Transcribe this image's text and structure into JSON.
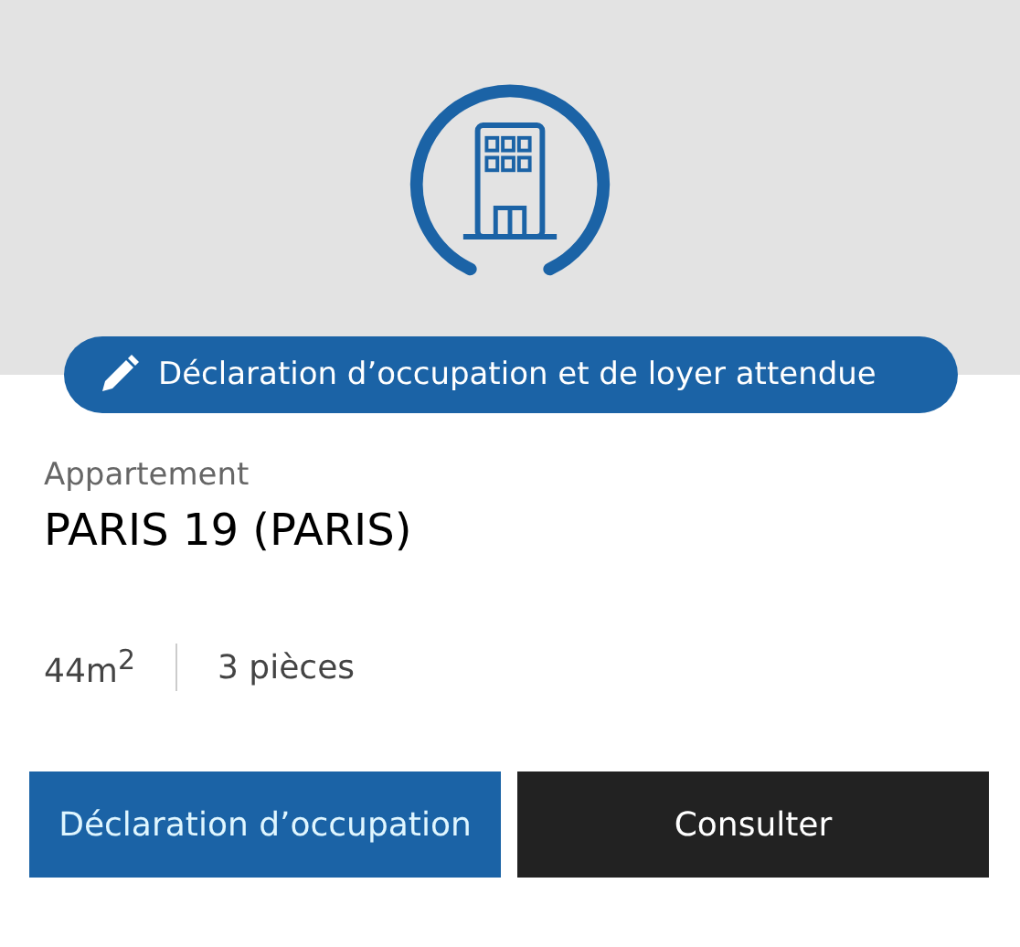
{
  "status_badge": {
    "label": "Déclaration d’occupation et de loyer attendue"
  },
  "property": {
    "type": "Appartement",
    "title": "PARIS 19 (PARIS)",
    "area": "44m$^{2}$",
    "rooms": "3 pièces"
  },
  "buttons": [
    {
      "label": "Déclaration d’occupation",
      "kind": "primary"
    },
    {
      "label": "Consulter",
      "kind": "dark"
    }
  ]
}
